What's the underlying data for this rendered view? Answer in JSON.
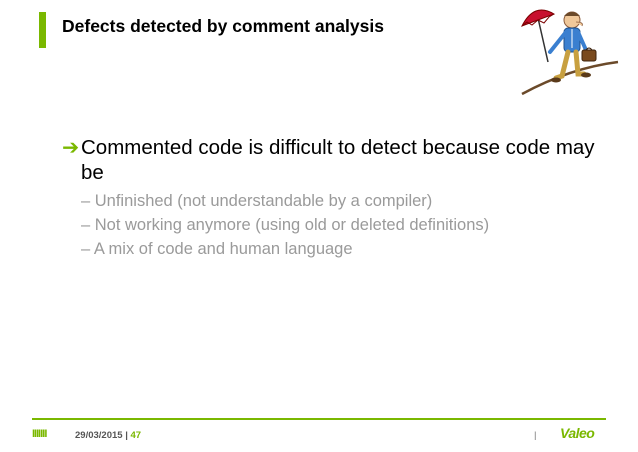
{
  "slide": {
    "title": "Defects detected by comment analysis",
    "main_bullet": {
      "marker": "➔",
      "text": "Commented code is difficult to detect because code may be"
    },
    "sub_bullets": [
      "– Unfinished (not understandable by a compiler)",
      "– Not working anymore (using old or deleted definitions)",
      "– A mix of code and human language"
    ]
  },
  "footer": {
    "marks": "IIIIIII",
    "date": "29/03/2015",
    "separator": "|",
    "page_number": "47",
    "right_separator": "|",
    "logo_text": "Valeo"
  },
  "colors": {
    "accent": "#7ab800",
    "sub_text": "#9a9a9a",
    "logo": "#7ab800",
    "umbrella": "#c8102e"
  },
  "icons": {
    "mascot": "tightrope-walker-with-umbrella-icon",
    "bullet": "arrow-right-icon"
  }
}
